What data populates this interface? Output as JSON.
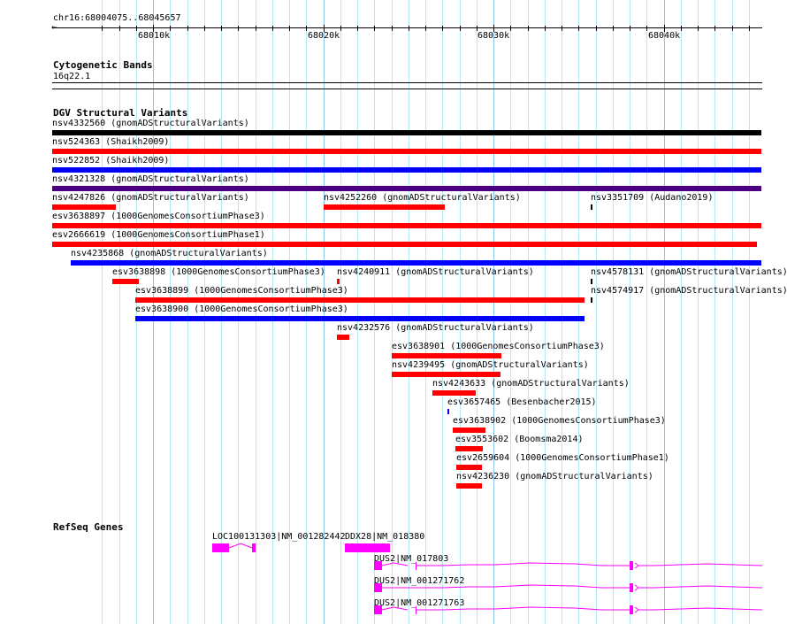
{
  "ruler": {
    "location": "chr16:68004075..68045657",
    "tick_labels": [
      "68010k",
      "68020k",
      "68030k",
      "68040k"
    ]
  },
  "cytobands": {
    "title": "Cytogenetic Bands",
    "band": "16q22.1"
  },
  "dgv": {
    "title": "DGV Structural Variants",
    "colors": {
      "loss": "#ff0000",
      "gain": "#0000ff",
      "complex": "#4b0082",
      "other": "#000000"
    },
    "features": [
      {
        "label": "nsv4332560 (gnomADStructuralVariants)",
        "color": "#000000"
      },
      {
        "label": "nsv524363 (Shaikh2009)",
        "color": "#ff0000"
      },
      {
        "label": "nsv522852 (Shaikh2009)",
        "color": "#0000ff"
      },
      {
        "label": "nsv4321328 (gnomADStructuralVariants)",
        "color": "#4b0082"
      },
      {
        "label": "nsv4247826 (gnomADStructuralVariants)",
        "color": "#ff0000"
      },
      {
        "label": "nsv4252260 (gnomADStructuralVariants)",
        "color": "#ff0000"
      },
      {
        "label": "nsv3351709 (Audano2019)",
        "color": "#000000"
      },
      {
        "label": "esv3638897 (1000GenomesConsortiumPhase3)",
        "color": "#ff0000"
      },
      {
        "label": "esv2666619 (1000GenomesConsortiumPhase1)",
        "color": "#ff0000"
      },
      {
        "label": "nsv4235868 (gnomADStructuralVariants)",
        "color": "#0000ff"
      },
      {
        "label": "esv3638898 (1000GenomesConsortiumPhase3)",
        "color": "#ff0000"
      },
      {
        "label": "nsv4240911 (gnomADStructuralVariants)",
        "color": "#ff0000"
      },
      {
        "label": "nsv4578131 (gnomADStructuralVariants)",
        "color": "#000000"
      },
      {
        "label": "esv3638899 (1000GenomesConsortiumPhase3)",
        "color": "#ff0000"
      },
      {
        "label": "nsv4574917 (gnomADStructuralVariants)",
        "color": "#000000"
      },
      {
        "label": "esv3638900 (1000GenomesConsortiumPhase3)",
        "color": "#0000ff"
      },
      {
        "label": "nsv4232576 (gnomADStructuralVariants)",
        "color": "#ff0000"
      },
      {
        "label": "esv3638901 (1000GenomesConsortiumPhase3)",
        "color": "#ff0000"
      },
      {
        "label": "nsv4239495 (gnomADStructuralVariants)",
        "color": "#ff0000"
      },
      {
        "label": "nsv4243633 (gnomADStructuralVariants)",
        "color": "#ff0000"
      },
      {
        "label": "esv3657465 (Besenbacher2015)",
        "color": "#0000ff"
      },
      {
        "label": "esv3638902 (1000GenomesConsortiumPhase3)",
        "color": "#ff0000"
      },
      {
        "label": "esv3553602 (Boomsma2014)",
        "color": "#ff0000"
      },
      {
        "label": "esv2659604 (1000GenomesConsortiumPhase1)",
        "color": "#ff0000"
      },
      {
        "label": "nsv4236230 (gnomADStructuralVariants)",
        "color": "#ff0000"
      }
    ]
  },
  "refseq": {
    "title": "RefSeq Genes",
    "color": "#ff00ff",
    "genes": [
      {
        "label": "LOC100131303|NM_001282442"
      },
      {
        "label": "DDX28|NM_018380"
      },
      {
        "label": "DUS2|NM_017803"
      },
      {
        "label": "DUS2|NM_001271762"
      },
      {
        "label": "DUS2|NM_001271763"
      }
    ]
  }
}
